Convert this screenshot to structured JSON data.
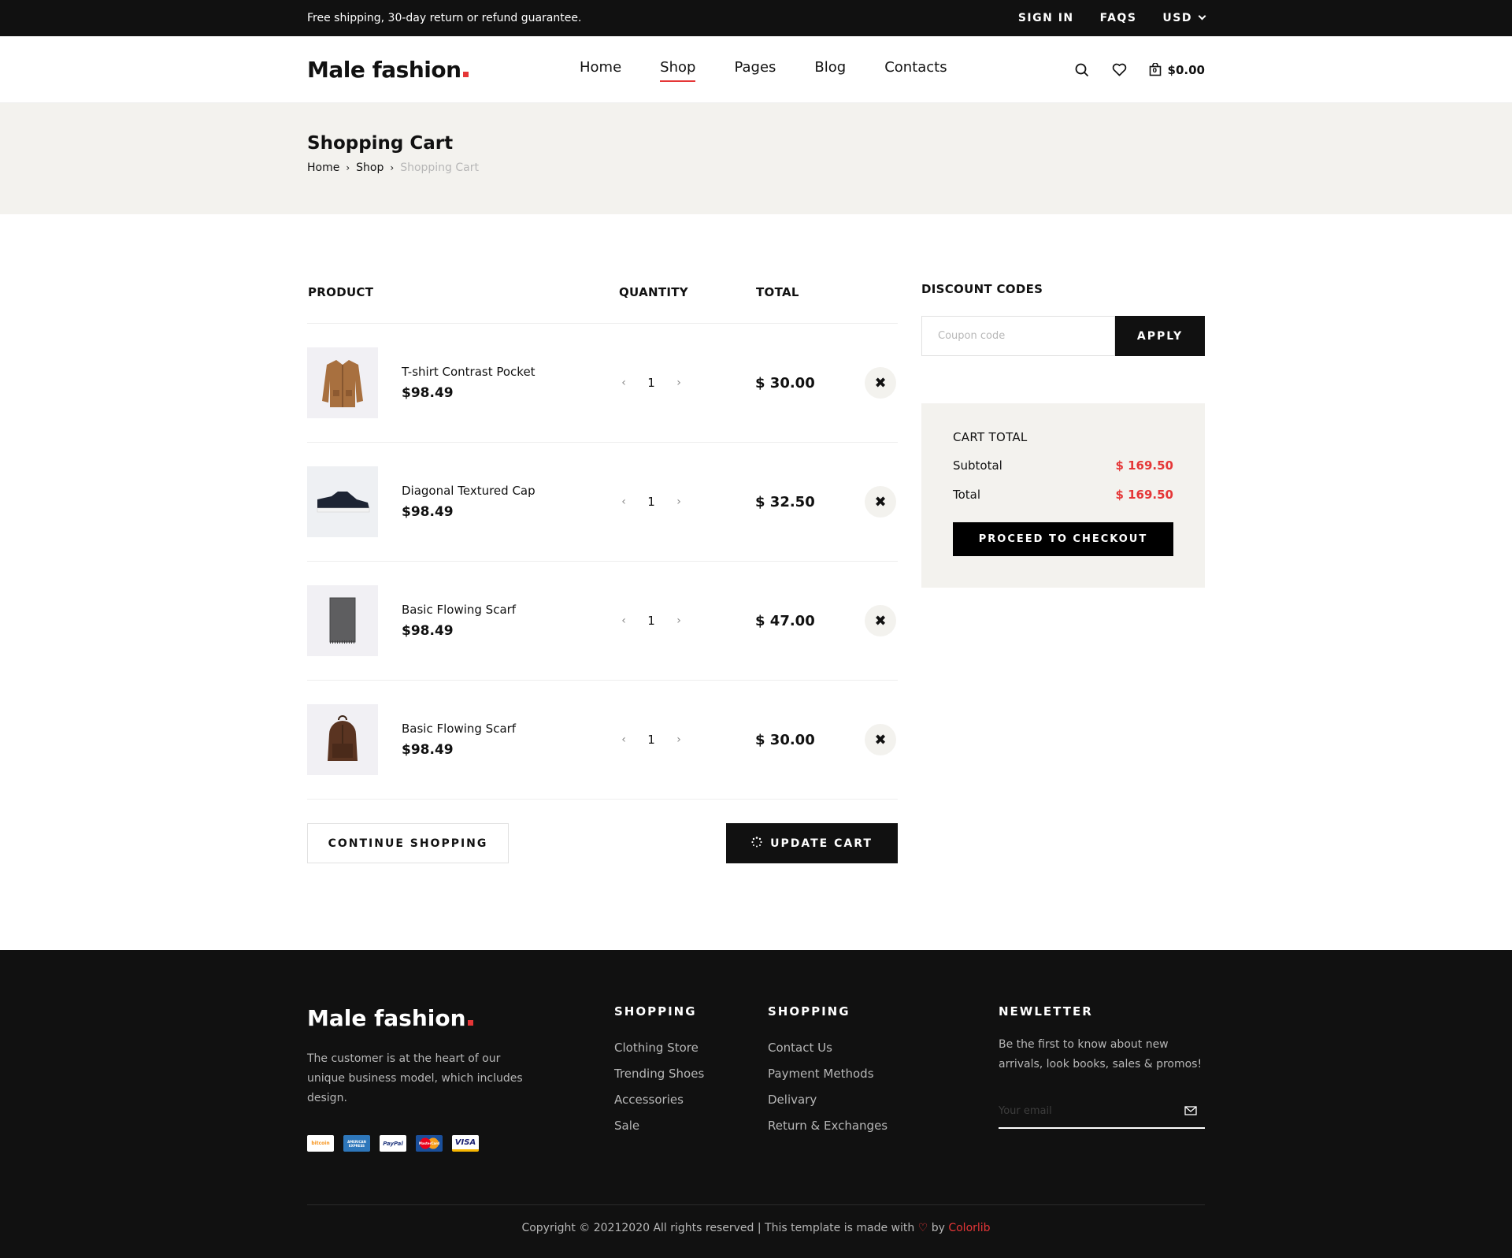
{
  "topbar": {
    "announcement": "Free shipping, 30-day return or refund guarantee.",
    "sign_in": "SIGN IN",
    "faqs": "FAQS",
    "currency": "USD"
  },
  "header": {
    "logo": "Male fashion",
    "nav": [
      "Home",
      "Shop",
      "Pages",
      "Blog",
      "Contacts"
    ],
    "active_nav": "Shop",
    "cart_total": "$0.00",
    "cart_count": "0"
  },
  "hero": {
    "title": "Shopping Cart",
    "breadcrumb": [
      "Home",
      "Shop",
      "Shopping Cart"
    ]
  },
  "cart": {
    "headers": {
      "product": "PRODUCT",
      "quantity": "QUANTITY",
      "total": "TOTAL"
    },
    "items": [
      {
        "name": "T-shirt Contrast Pocket",
        "price": "$98.49",
        "qty": "1",
        "total": "$ 30.00",
        "icon": "jacket-image"
      },
      {
        "name": "Diagonal Textured Cap",
        "price": "$98.49",
        "qty": "1",
        "total": "$ 32.50",
        "icon": "shoe-image"
      },
      {
        "name": "Basic Flowing Scarf",
        "price": "$98.49",
        "qty": "1",
        "total": "$ 47.00",
        "icon": "scarf-image"
      },
      {
        "name": "Basic Flowing Scarf",
        "price": "$98.49",
        "qty": "1",
        "total": "$ 30.00",
        "icon": "backpack-image"
      }
    ],
    "continue_label": "CONTINUE SHOPPING",
    "update_label": "UPDATE CART"
  },
  "discount": {
    "title": "DISCOUNT CODES",
    "placeholder": "Coupon code",
    "apply_label": "APPLY"
  },
  "cart_total": {
    "title": "CART TOTAL",
    "subtotal_label": "Subtotal",
    "subtotal_value": "$ 169.50",
    "total_label": "Total",
    "total_value": "$ 169.50",
    "checkout_label": "PROCEED TO CHECKOUT"
  },
  "footer": {
    "logo": "Male fashion",
    "description": "The customer is at the heart of our unique business model, which includes design.",
    "payment_cards": [
      "bitcoin",
      "AMERICAN EXPRESS",
      "PayPal",
      "MasterCard",
      "VISA"
    ],
    "col1_title": "SHOPPING",
    "col1_links": [
      "Clothing Store",
      "Trending Shoes",
      "Accessories",
      "Sale"
    ],
    "col2_title": "SHOPPING",
    "col2_links": [
      "Contact Us",
      "Payment Methods",
      "Delivary",
      "Return & Exchanges"
    ],
    "news_title": "NEWLETTER",
    "news_text": "Be the first to know about new arrivals, look books, sales & promos!",
    "email_placeholder": "Your email",
    "copyright_prefix": "Copyright © 20212020 All rights reserved | This template is made with",
    "copyright_by": "by",
    "copyright_brand": "Colorlib"
  },
  "colors": {
    "accent": "#e53637",
    "dark": "#111111",
    "light_bg": "#f3f2ee"
  }
}
